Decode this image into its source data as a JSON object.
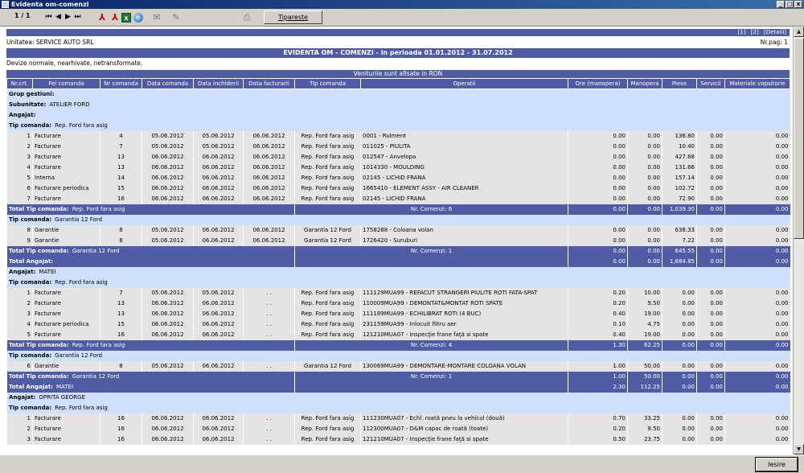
{
  "window": {
    "title": "Evidenta om-comenzi",
    "btn_min": "_",
    "btn_max": "□",
    "btn_close": "x"
  },
  "toolbar": {
    "page_indicator": "1 / 1",
    "nav_first": "|◀",
    "nav_prev": "◀",
    "nav_next": "▶",
    "nav_last": "▶|",
    "print_label": "Tipareste"
  },
  "report": {
    "links": [
      "[1]",
      "[2]",
      "[Detalii]"
    ],
    "unit": "Unitatea: SERVICE AUTO SRL",
    "page_no": "Nr.pag: 1",
    "title": "EVIDENTA OM - COMENZI - in perioada 01.01.2012 - 31.07.2012",
    "currency_note": "Devize normale, nearhivate, netransformate.",
    "ron_note": "Veniturile sunt afisate in RON",
    "columns": [
      "Nr.crt.",
      "Fel comanda",
      "Nr comanda",
      "Data comanda",
      "Data inchiderii",
      "Data facturarii",
      "Tip comanda",
      "Operatii",
      "Ore (manopera)",
      "Manopera",
      "Piese",
      "Servicii",
      "Materiale vopsitorie"
    ]
  },
  "rows": [
    {
      "kind": "grp",
      "label": "Grup gestiuni:",
      "value": ""
    },
    {
      "kind": "grp",
      "label": "Subunitate:",
      "value": "ATELIER FORD"
    },
    {
      "kind": "grp",
      "label": "Angajat:",
      "value": ""
    },
    {
      "kind": "grp",
      "label": "Tip comanda:",
      "value": "Rep. Ford fara asig"
    },
    {
      "kind": "dat",
      "cells": [
        "1",
        "Facturare",
        "4",
        "05.06.2012",
        "05.06.2012",
        "06.06.2012",
        "Rep. Ford fara asig",
        "0001 - Rulment",
        "0.00",
        "0.00",
        "136.80",
        "0.00",
        "0.00"
      ]
    },
    {
      "kind": "dat",
      "cells": [
        "2",
        "Facturare",
        "7",
        "05.06.2012",
        "05.06.2012",
        "06.06.2012",
        "Rep. Ford fara asig",
        "011025 - PIULITA",
        "0.00",
        "0.00",
        "10.40",
        "0.00",
        "0.00"
      ]
    },
    {
      "kind": "dat",
      "cells": [
        "3",
        "Facturare",
        "13",
        "06.06.2012",
        "06.06.2012",
        "06.06.2012",
        "Rep. Ford fara asig",
        "012547 - Anvelopa",
        "0.00",
        "0.00",
        "427.68",
        "0.00",
        "0.00"
      ]
    },
    {
      "kind": "dat",
      "cells": [
        "4",
        "Facturare",
        "13",
        "06.06.2012",
        "06.06.2012",
        "06.06.2012",
        "Rep. Ford fara asig",
        "1014330 - MOULDING",
        "0.00",
        "0.00",
        "131.66",
        "0.00",
        "0.00"
      ]
    },
    {
      "kind": "dat",
      "cells": [
        "5",
        "Interna",
        "14",
        "06.06.2012",
        "06.06.2012",
        "06.06.2012",
        "Rep. Ford fara asig",
        "02145 - LICHID FRANA",
        "0.00",
        "0.00",
        "157.14",
        "0.00",
        "0.00"
      ]
    },
    {
      "kind": "dat",
      "cells": [
        "6",
        "Facturare periodica",
        "15",
        "06.06.2012",
        "06.06.2012",
        "06.06.2012",
        "Rep. Ford fara asig",
        "1665410 - ELEMENT ASSY - AIR CLEANER",
        "0.00",
        "0.00",
        "102.72",
        "0.00",
        "0.00"
      ]
    },
    {
      "kind": "dat",
      "cells": [
        "7",
        "Facturare",
        "16",
        "06.06.2012",
        "06.06.2012",
        "06.06.2012",
        "Rep. Ford fara asig",
        "02145 - LICHID FRANA",
        "0.00",
        "0.00",
        "72.90",
        "0.00",
        "0.00"
      ]
    },
    {
      "kind": "tot",
      "label": "Total Tip comanda:",
      "value": "Rep. Ford fara asig",
      "count": "Nr. Comenzi: 6",
      "nums": [
        "0.00",
        "0.00",
        "1,039.30",
        "0.00",
        "0.00"
      ]
    },
    {
      "kind": "grp",
      "label": "Tip comanda:",
      "value": "Garantia 12 Ford"
    },
    {
      "kind": "dat",
      "cells": [
        "8",
        "Garantie",
        "8",
        "05.06.2012",
        "06.06.2012",
        "06.06.2012",
        "Garantia 12 Ford",
        "1758288 - Coloana volan",
        "0.00",
        "0.00",
        "638.33",
        "0.00",
        "0.00"
      ]
    },
    {
      "kind": "dat",
      "cells": [
        "9",
        "Garantie",
        "8",
        "05.06.2012",
        "06.06.2012",
        "06.06.2012",
        "Garantia 12 Ford",
        "1726420 - Suruburi",
        "0.00",
        "0.00",
        "7.22",
        "0.00",
        "0.00"
      ]
    },
    {
      "kind": "tot",
      "label": "Total Tip comanda:",
      "value": "Garantia 12 Ford",
      "count": "Nr. Comenzi: 1",
      "nums": [
        "0.00",
        "0.00",
        "645.55",
        "0.00",
        "0.00"
      ]
    },
    {
      "kind": "tot",
      "label": "Total Angajat:",
      "value": "",
      "count": "",
      "nums": [
        "0.00",
        "0.00",
        "1,684.85",
        "0.00",
        "0.00"
      ]
    },
    {
      "kind": "grp",
      "label": "Angajat:",
      "value": "MATEI"
    },
    {
      "kind": "grp",
      "label": "Tip comanda:",
      "value": "Rep. Ford fara asig"
    },
    {
      "kind": "dat",
      "cells": [
        "1",
        "Facturare",
        "7",
        "05.06.2012",
        "05.06.2012",
        ". .",
        "Rep. Ford fara asig",
        "111129MUA99 - REFACUT STRANGERI PIULITE ROTI FATA-SPAT",
        "0.20",
        "10.00",
        "0.00",
        "0.00",
        "0.00"
      ]
    },
    {
      "kind": "dat",
      "cells": [
        "2",
        "Facturare",
        "13",
        "06.06.2012",
        "06.06.2012",
        ". .",
        "Rep. Ford fara asig",
        "110009MUA99 - DEMONTAT&MONTAT ROTI SPATE",
        "0.20",
        "9.50",
        "0.00",
        "0.00",
        "0.00"
      ]
    },
    {
      "kind": "dat",
      "cells": [
        "3",
        "Facturare",
        "13",
        "06.06.2012",
        "06.06.2012",
        ". .",
        "Rep. Ford fara asig",
        "111189MUA99 - ECHILIBRAT ROTI (4 BUC)",
        "0.40",
        "19.00",
        "0.00",
        "0.00",
        "0.00"
      ]
    },
    {
      "kind": "dat",
      "cells": [
        "4",
        "Facturare periodica",
        "15",
        "06.06.2012",
        "06.06.2012",
        ". .",
        "Rep. Ford fara asig",
        "231159MUA99 - Inlocuit filtru aer",
        "0.10",
        "4.75",
        "0.00",
        "0.00",
        "0.00"
      ]
    },
    {
      "kind": "dat",
      "cells": [
        "5",
        "Facturare",
        "16",
        "06.06.2012",
        "06.06.2012",
        ". .",
        "Rep. Ford fara asig",
        "121210MUA07 - Inspecţie frane faţă si spate",
        "0.40",
        "19.00",
        "0.00",
        "0.00",
        "0.00"
      ]
    },
    {
      "kind": "tot",
      "label": "Total Tip comanda:",
      "value": "Rep. Ford fara asig",
      "count": "Nr. Comenzi: 4",
      "nums": [
        "1.30",
        "62.25",
        "0.00",
        "0.00",
        "0.00"
      ]
    },
    {
      "kind": "grp",
      "label": "Tip comanda:",
      "value": "Garantia 12 Ford"
    },
    {
      "kind": "dat",
      "cells": [
        "6",
        "Garantie",
        "8",
        "05.06.2012",
        "06.06.2012",
        ". .",
        "Garantia 12 Ford",
        "130069MUA99 - DEMONTARE-MONTARE COLOANA VOLAN",
        "1.00",
        "50.00",
        "0.00",
        "0.00",
        "0.00"
      ]
    },
    {
      "kind": "tot",
      "label": "Total Tip comanda:",
      "value": "Garantia 12 Ford",
      "count": "Nr. Comenzi: 1",
      "nums": [
        "1.00",
        "50.00",
        "0.00",
        "0.00",
        "0.00"
      ]
    },
    {
      "kind": "tot",
      "label": "Total Angajat:",
      "value": "MATEI",
      "count": "",
      "nums": [
        "2.30",
        "112.25",
        "0.00",
        "0.00",
        "0.00"
      ]
    },
    {
      "kind": "grp",
      "label": "Angajat:",
      "value": "OPRITA GEORGE"
    },
    {
      "kind": "grp",
      "label": "Tip comanda:",
      "value": "Rep. Ford fara asig"
    },
    {
      "kind": "dat",
      "cells": [
        "1",
        "Facturare",
        "16",
        "06.06.2012",
        "06.06.2012",
        ". .",
        "Rep. Ford fara asig",
        "111230MUA07 - Echl. roată pneu la vehicul (două)",
        "0.70",
        "33.25",
        "0.00",
        "0.00",
        "0.00"
      ]
    },
    {
      "kind": "dat",
      "cells": [
        "2",
        "Facturare",
        "16",
        "06.06.2012",
        "06.06.2012",
        ". .",
        "Rep. Ford fara asig",
        "112300MUA07 - D&M capac de roată (toate)",
        "0.20",
        "9.50",
        "0.00",
        "0.00",
        "0.00"
      ]
    },
    {
      "kind": "dat",
      "cells": [
        "3",
        "Facturare",
        "16",
        "06.06.2012",
        "06.06.2012",
        ". .",
        "Rep. Ford fara asig",
        "121210MUA07 - Inspecţie frane faţă si spate",
        "0.50",
        "23.75",
        "0.00",
        "0.00",
        "0.00"
      ]
    }
  ],
  "footer": {
    "exit_label": "Iesire"
  }
}
